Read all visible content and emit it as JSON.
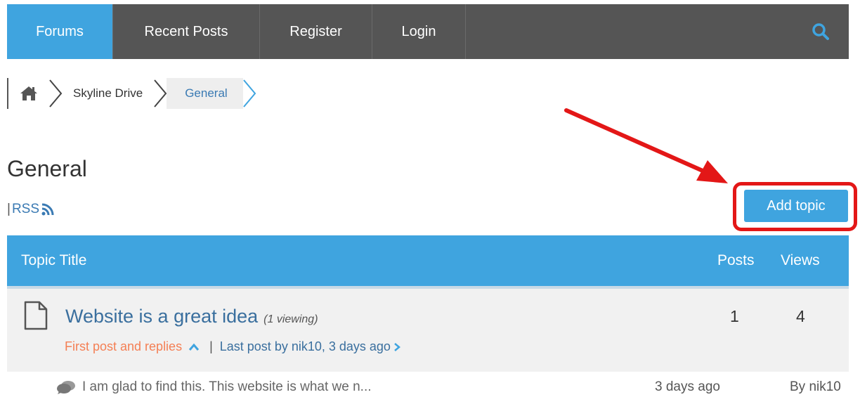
{
  "nav": {
    "items": [
      {
        "label": "Forums",
        "active": true
      },
      {
        "label": "Recent Posts",
        "active": false
      },
      {
        "label": "Register",
        "active": false
      },
      {
        "label": "Login",
        "active": false
      }
    ],
    "search_icon": "search-icon"
  },
  "breadcrumb": {
    "home_icon": "home-icon",
    "items": [
      "Skyline Drive",
      "General"
    ]
  },
  "page": {
    "title": "General",
    "rss_label": "RSS",
    "rss_prefix": "|",
    "add_topic_label": "Add topic"
  },
  "table": {
    "headers": {
      "title": "Topic Title",
      "posts": "Posts",
      "views": "Views"
    },
    "topic": {
      "title": "Website is a great idea",
      "viewing": "(1 viewing)",
      "first_post_label": "First post and replies",
      "separator": "|",
      "last_post_label": "Last post by nik10, 3 days ago",
      "posts": "1",
      "views": "4"
    },
    "reply": {
      "excerpt": "I am glad to find this.  This website is what we n...",
      "time": "3 days ago",
      "author": "By nik10"
    }
  },
  "colors": {
    "accent": "#3fa4df",
    "nav_bg": "#555555",
    "highlight": "#e31717",
    "first_post": "#f47f54",
    "link": "#3a6f9e"
  }
}
